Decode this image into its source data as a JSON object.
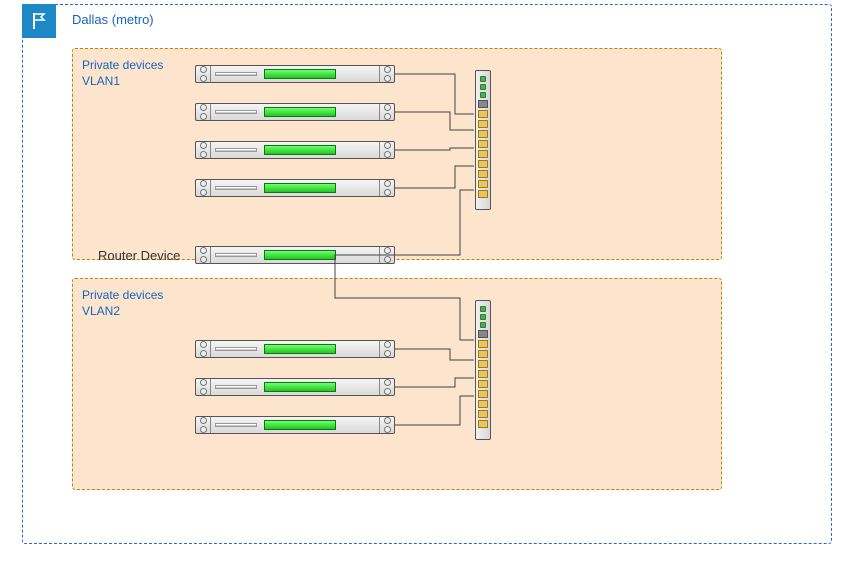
{
  "metro": {
    "label": "Dallas (metro)"
  },
  "router": {
    "label": "Router Device"
  },
  "vlan1": {
    "label_line1": "Private devices",
    "label_line2": "VLAN1",
    "server_count": 4
  },
  "vlan2": {
    "label_line1": "Private devices",
    "label_line2": "VLAN2",
    "server_count": 3
  },
  "chart_data": {
    "type": "diagram",
    "title": "Dallas (metro) network topology",
    "nodes": [
      {
        "id": "metro",
        "type": "region",
        "label": "Dallas (metro)"
      },
      {
        "id": "vlan1",
        "type": "vlan",
        "label": "Private devices VLAN1",
        "parent": "metro"
      },
      {
        "id": "vlan2",
        "type": "vlan",
        "label": "Private devices VLAN2",
        "parent": "metro"
      },
      {
        "id": "sw1",
        "type": "switch",
        "parent": "vlan1"
      },
      {
        "id": "sw2",
        "type": "switch",
        "parent": "vlan2"
      },
      {
        "id": "srv1a",
        "type": "server",
        "parent": "vlan1"
      },
      {
        "id": "srv1b",
        "type": "server",
        "parent": "vlan1"
      },
      {
        "id": "srv1c",
        "type": "server",
        "parent": "vlan1"
      },
      {
        "id": "srv1d",
        "type": "server",
        "parent": "vlan1"
      },
      {
        "id": "srv2a",
        "type": "server",
        "parent": "vlan2"
      },
      {
        "id": "srv2b",
        "type": "server",
        "parent": "vlan2"
      },
      {
        "id": "srv2c",
        "type": "server",
        "parent": "vlan2"
      },
      {
        "id": "router",
        "type": "router",
        "label": "Router Device",
        "parent": "metro"
      }
    ],
    "edges": [
      {
        "from": "srv1a",
        "to": "sw1"
      },
      {
        "from": "srv1b",
        "to": "sw1"
      },
      {
        "from": "srv1c",
        "to": "sw1"
      },
      {
        "from": "srv1d",
        "to": "sw1"
      },
      {
        "from": "srv2a",
        "to": "sw2"
      },
      {
        "from": "srv2b",
        "to": "sw2"
      },
      {
        "from": "srv2c",
        "to": "sw2"
      },
      {
        "from": "router",
        "to": "sw1"
      },
      {
        "from": "router",
        "to": "sw2"
      }
    ]
  }
}
